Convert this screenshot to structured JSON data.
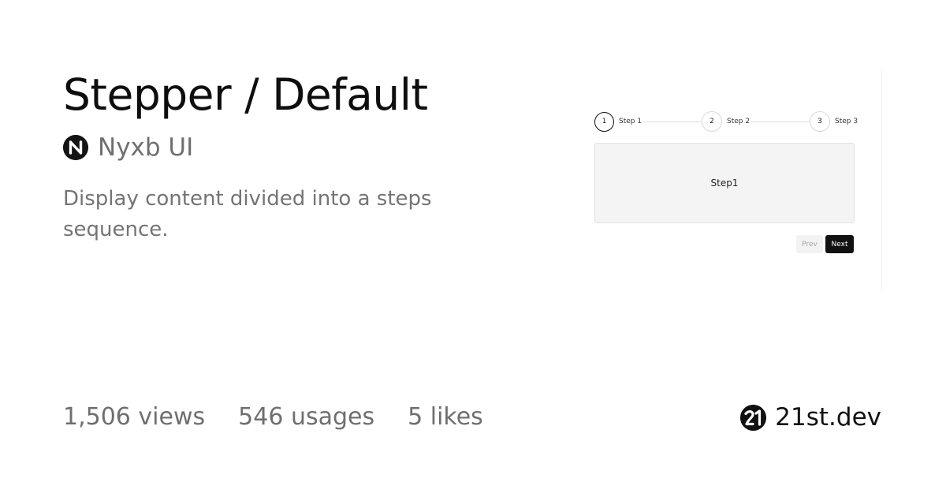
{
  "header": {
    "title": "Stepper / Default",
    "author": "Nyxb UI",
    "description": "Display content divided into a steps sequence."
  },
  "stats": {
    "views": "1,506 views",
    "usages": "546 usages",
    "likes": "5 likes"
  },
  "brand": {
    "name": "21st.dev"
  },
  "preview": {
    "steps": [
      {
        "number": "1",
        "label": "Step 1",
        "active": true
      },
      {
        "number": "2",
        "label": "Step 2",
        "active": false
      },
      {
        "number": "3",
        "label": "Step 3",
        "active": false
      }
    ],
    "content": "Step1",
    "prev_label": "Prev",
    "next_label": "Next"
  },
  "colors": {
    "title": "#0e0e0e",
    "muted_text": "#6f6f6f",
    "primary_button": "#111111",
    "panel_background": "#f4f4f4"
  },
  "icons": {
    "author_logo": "nyxb-logo-icon",
    "brand_logo": "21st-logo-icon"
  }
}
